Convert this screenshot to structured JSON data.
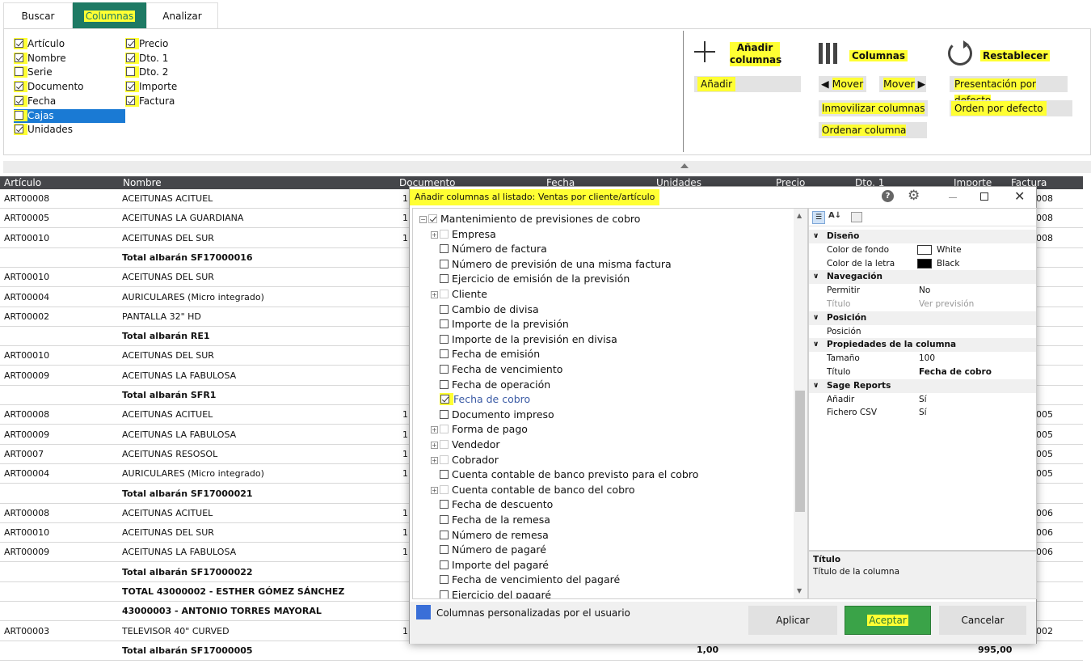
{
  "tabs": {
    "buscar": "Buscar",
    "columnas": "Columnas",
    "analizar": "Analizar"
  },
  "checks": {
    "col1": [
      {
        "label": "Artículo",
        "checked": true
      },
      {
        "label": "Nombre",
        "checked": true
      },
      {
        "label": "Serie",
        "checked": false
      },
      {
        "label": "Documento",
        "checked": true
      },
      {
        "label": "Fecha",
        "checked": true
      },
      {
        "label": "Cajas",
        "checked": false
      },
      {
        "label": "Unidades",
        "checked": true
      }
    ],
    "col2": [
      {
        "label": "Precio",
        "checked": true
      },
      {
        "label": "Dto. 1",
        "checked": true
      },
      {
        "label": "Dto. 2",
        "checked": false
      },
      {
        "label": "Importe",
        "checked": true
      },
      {
        "label": "Factura",
        "checked": true
      }
    ]
  },
  "ribbon": {
    "anadir_columnas": "Añadir columnas",
    "anadir": "Añadir",
    "columnas": "Columnas",
    "mover_left": "Mover",
    "mover_right": "Mover",
    "inmovilizar": "Inmovilizar columnas",
    "ordenar": "Ordenar columna",
    "restablecer": "Restablecer",
    "presentacion": "Presentación por defecto",
    "orden": "Orden por defecto"
  },
  "grid": {
    "headers": {
      "articulo": "Artículo",
      "nombre": "Nombre",
      "documento": "Documento",
      "fecha": "Fecha",
      "unidades": "Unidades",
      "precio": "Precio",
      "dto1": "Dto. 1",
      "importe": "Importe",
      "factura": "Factura"
    },
    "rows": [
      {
        "art": "ART00008",
        "nombre": "ACEITUNAS ACITUEL",
        "doc": "1",
        "fac": "008",
        "bold": false
      },
      {
        "art": "ART00005",
        "nombre": "ACEITUNAS LA GUARDIANA",
        "doc": "1",
        "fac": "008",
        "bold": false
      },
      {
        "art": "ART00010",
        "nombre": "ACEITUNAS DEL SUR",
        "doc": "1",
        "fac": "008",
        "bold": false
      },
      {
        "art": "",
        "nombre": "Total albarán SF17000016",
        "doc": "",
        "fac": "",
        "bold": true
      },
      {
        "art": "ART00010",
        "nombre": "ACEITUNAS DEL SUR",
        "doc": "",
        "fac": "",
        "bold": false
      },
      {
        "art": "ART00004",
        "nombre": "AURICULARES (Micro integrado)",
        "doc": "",
        "fac": "",
        "bold": false
      },
      {
        "art": "ART00002",
        "nombre": "PANTALLA 32\" HD",
        "doc": "",
        "fac": "",
        "bold": false
      },
      {
        "art": "",
        "nombre": "Total albarán RE1",
        "doc": "",
        "fac": "",
        "bold": true
      },
      {
        "art": "ART00010",
        "nombre": "ACEITUNAS DEL SUR",
        "doc": "",
        "fac": "",
        "bold": false
      },
      {
        "art": "ART00009",
        "nombre": "ACEITUNAS LA FABULOSA",
        "doc": "",
        "fac": "",
        "bold": false
      },
      {
        "art": "",
        "nombre": "Total albarán SFR1",
        "doc": "",
        "fac": "",
        "bold": true
      },
      {
        "art": "ART00008",
        "nombre": "ACEITUNAS ACITUEL",
        "doc": "1",
        "fac": "005",
        "bold": false
      },
      {
        "art": "ART00009",
        "nombre": "ACEITUNAS LA FABULOSA",
        "doc": "1",
        "fac": "005",
        "bold": false
      },
      {
        "art": "ART0007",
        "nombre": "ACEITUNAS RESOSOL",
        "doc": "1",
        "fac": "005",
        "bold": false
      },
      {
        "art": "ART00004",
        "nombre": "AURICULARES (Micro integrado)",
        "doc": "1",
        "fac": "005",
        "bold": false
      },
      {
        "art": "",
        "nombre": "Total albarán SF17000021",
        "doc": "",
        "fac": "",
        "bold": true
      },
      {
        "art": "ART00008",
        "nombre": "ACEITUNAS ACITUEL",
        "doc": "1",
        "fac": "006",
        "bold": false
      },
      {
        "art": "ART00010",
        "nombre": "ACEITUNAS DEL SUR",
        "doc": "1",
        "fac": "006",
        "bold": false
      },
      {
        "art": "ART00009",
        "nombre": "ACEITUNAS LA FABULOSA",
        "doc": "1",
        "fac": "006",
        "bold": false
      },
      {
        "art": "",
        "nombre": "Total albarán SF17000022",
        "doc": "",
        "fac": "",
        "bold": true
      },
      {
        "art": "",
        "nombre": "TOTAL 43000002 - ESTHER GÓMEZ SÁNCHEZ",
        "doc": "",
        "fac": "",
        "bold": true
      },
      {
        "art": "",
        "nombre": "43000003 - ANTONIO TORRES MAYORAL",
        "doc": "",
        "fac": "",
        "bold": true
      },
      {
        "art": "ART00003",
        "nombre": "TELEVISOR 40\" CURVED",
        "doc": "1",
        "fac": "002",
        "bold": false
      },
      {
        "art": "",
        "nombre": "Total albarán SF17000005",
        "doc": "",
        "fac": "",
        "bold": true
      }
    ],
    "last_unidades": "1,00",
    "last_importe": "995,00"
  },
  "dialog": {
    "title": "Añadir columnas al listado: Ventas por cliente/artículo",
    "tree": [
      {
        "label": "Mantenimiento de previsiones de cobro",
        "type": "root"
      },
      {
        "label": "Empresa",
        "type": "group"
      },
      {
        "label": "Número de factura",
        "type": "leaf",
        "checked": false
      },
      {
        "label": "Número de previsión de una misma factura",
        "type": "leaf",
        "checked": false
      },
      {
        "label": "Ejercicio de emisión de la previsión",
        "type": "leaf",
        "checked": false
      },
      {
        "label": "Cliente",
        "type": "group"
      },
      {
        "label": "Cambio de divisa",
        "type": "leaf",
        "checked": false
      },
      {
        "label": "Importe de la previsión",
        "type": "leaf",
        "checked": false
      },
      {
        "label": "Importe de la previsión en divisa",
        "type": "leaf",
        "checked": false
      },
      {
        "label": "Fecha de emisión",
        "type": "leaf",
        "checked": false
      },
      {
        "label": "Fecha de vencimiento",
        "type": "leaf",
        "checked": false
      },
      {
        "label": "Fecha de operación",
        "type": "leaf",
        "checked": false
      },
      {
        "label": "Fecha de cobro",
        "type": "leaf",
        "checked": true
      },
      {
        "label": "Documento impreso",
        "type": "leaf",
        "checked": false
      },
      {
        "label": "Forma de pago",
        "type": "group"
      },
      {
        "label": "Vendedor",
        "type": "group"
      },
      {
        "label": "Cobrador",
        "type": "group"
      },
      {
        "label": "Cuenta contable de banco previsto para el cobro",
        "type": "leaf",
        "checked": false
      },
      {
        "label": "Cuenta contable de banco del cobro",
        "type": "group"
      },
      {
        "label": "Fecha de descuento",
        "type": "leaf",
        "checked": false
      },
      {
        "label": "Fecha de la remesa",
        "type": "leaf",
        "checked": false
      },
      {
        "label": "Número de remesa",
        "type": "leaf",
        "checked": false
      },
      {
        "label": "Número de pagaré",
        "type": "leaf",
        "checked": false
      },
      {
        "label": "Importe del pagaré",
        "type": "leaf",
        "checked": false
      },
      {
        "label": "Fecha de vencimiento del pagaré",
        "type": "leaf",
        "checked": false
      },
      {
        "label": "Ejercicio del pagaré",
        "type": "leaf",
        "checked": false
      }
    ],
    "props": [
      {
        "kind": "cat",
        "label": "Diseño"
      },
      {
        "kind": "prop",
        "name": "Color de fondo",
        "value": "White",
        "swatch": "#ffffff"
      },
      {
        "kind": "prop",
        "name": "Color de la letra",
        "value": "Black",
        "swatch": "#000000"
      },
      {
        "kind": "cat",
        "label": "Navegación"
      },
      {
        "kind": "prop",
        "name": "Permitir",
        "value": "No"
      },
      {
        "kind": "prop",
        "name": "Título",
        "value": "Ver previsión",
        "dim": true
      },
      {
        "kind": "cat",
        "label": "Posición"
      },
      {
        "kind": "prop",
        "name": "Posición",
        "value": ""
      },
      {
        "kind": "cat",
        "label": "Propiedades de la columna"
      },
      {
        "kind": "prop",
        "name": "Tamaño",
        "value": "100"
      },
      {
        "kind": "prop",
        "name": "Título",
        "value": "Fecha de cobro",
        "bold": true
      },
      {
        "kind": "cat",
        "label": "Sage Reports"
      },
      {
        "kind": "prop",
        "name": "Añadir",
        "value": "Sí"
      },
      {
        "kind": "prop",
        "name": "Fichero CSV",
        "value": "Sí"
      }
    ],
    "desc_title": "Título",
    "desc_text": "Título de la columna",
    "legend": "Columnas personalizadas por el usuario",
    "legend_color": "#3a6fd8",
    "aplicar": "Aplicar",
    "aceptar": "Aceptar",
    "cancelar": "Cancelar"
  }
}
